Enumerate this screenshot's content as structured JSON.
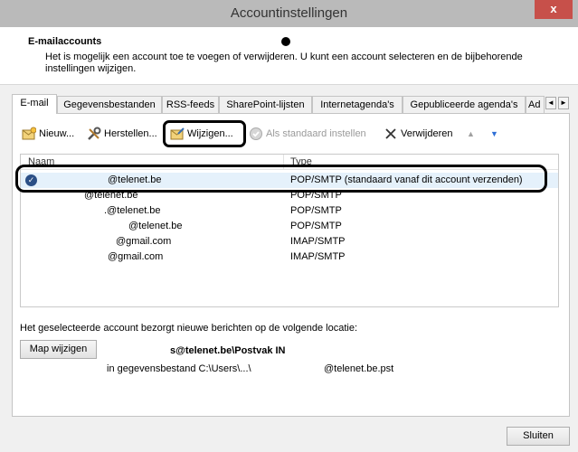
{
  "window": {
    "title": "Accountinstellingen",
    "close_glyph": "x"
  },
  "header": {
    "title": "E-mailaccounts",
    "description": "Het is mogelijk een account toe te voegen of verwijderen. U kunt een account selecteren en de bijbehorende instellingen wijzigen."
  },
  "tabs": [
    "E-mail",
    "Gegevensbestanden",
    "RSS-feeds",
    "SharePoint-lijsten",
    "Internetagenda's",
    "Gepubliceerde agenda's",
    "Ad"
  ],
  "tab_scroll": {
    "left": "◄",
    "right": "►"
  },
  "toolbar": {
    "new": "Nieuw...",
    "repair": "Herstellen...",
    "change": "Wijzigen...",
    "set_default": "Als standaard instellen",
    "remove": "Verwijderen",
    "up_glyph": "▲",
    "down_glyph": "▼"
  },
  "list": {
    "columns": {
      "name": "Naam",
      "type": "Type"
    },
    "rows": [
      {
        "name": "@telenet.be",
        "type": "POP/SMTP (standaard vanaf dit account verzenden)",
        "default": true
      },
      {
        "name": "@telenet.be",
        "type": "POP/SMTP"
      },
      {
        "name": ".@telenet.be",
        "type": "POP/SMTP"
      },
      {
        "name": "@telenet.be",
        "type": "POP/SMTP"
      },
      {
        "name": "@gmail.com",
        "type": "IMAP/SMTP"
      },
      {
        "name": "@gmail.com",
        "type": "IMAP/SMTP"
      }
    ],
    "default_check_glyph": "✓"
  },
  "location": {
    "label": "Het geselecteerde account bezorgt nieuwe berichten op de volgende locatie:",
    "change_folder": "Map wijzigen",
    "path": "s@telenet.be\\Postvak IN",
    "file_prefix": "in gegevensbestand C:\\Users\\...\\",
    "file_suffix": "@telenet.be.pst"
  },
  "footer": {
    "close": "Sluiten"
  }
}
